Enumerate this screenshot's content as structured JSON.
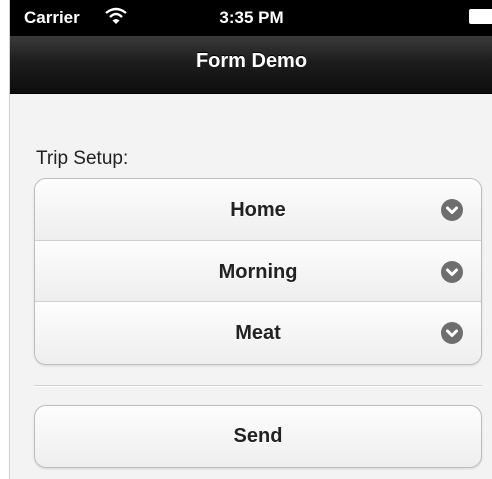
{
  "status_bar": {
    "carrier": "Carrier",
    "time": "3:35 PM",
    "wifi_icon": "wifi-icon",
    "battery_icon": "battery-icon"
  },
  "nav_bar": {
    "title": "Form Demo"
  },
  "form": {
    "section_label": "Trip Setup:",
    "selects": [
      {
        "value": "Home",
        "icon": "chevron-down-icon"
      },
      {
        "value": "Morning",
        "icon": "chevron-down-icon"
      },
      {
        "value": "Meat",
        "icon": "chevron-down-icon"
      }
    ],
    "send_label": "Send"
  },
  "colors": {
    "navbar": "#1d1d1d",
    "statusbar": "#000000",
    "background": "#f3f3f3",
    "chevron": "#6e6e6e"
  }
}
